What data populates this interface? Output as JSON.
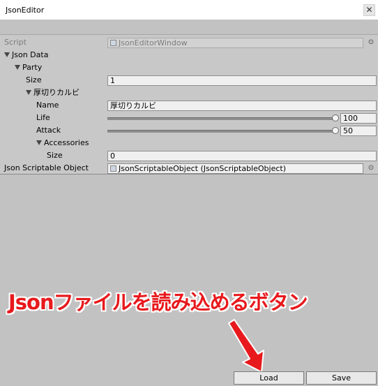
{
  "window": {
    "title": "JsonEditor",
    "close_glyph": "✕"
  },
  "inspector": {
    "script": {
      "label": "Script",
      "value": "JsonEditorWindow"
    },
    "json_data": {
      "label": "Json Data"
    },
    "party": {
      "label": "Party"
    },
    "party_size": {
      "label": "Size",
      "value": "1"
    },
    "member": {
      "label": "厚切りカルビ"
    },
    "name": {
      "label": "Name",
      "value": "厚切りカルビ"
    },
    "life": {
      "label": "Life",
      "value": "100",
      "slider_fraction": 1.0
    },
    "attack": {
      "label": "Attack",
      "value": "50",
      "slider_fraction": 1.0
    },
    "accessories": {
      "label": "Accessories"
    },
    "acc_size": {
      "label": "Size",
      "value": "0"
    },
    "scriptable": {
      "label": "Json Scriptable Object",
      "value": "JsonScriptableObject (JsonScriptableObject)"
    },
    "picker_glyph": "⊙"
  },
  "buttons": {
    "load": "Load",
    "save": "Save"
  },
  "annotation": {
    "text": "Jsonファイルを読み込めるボタン",
    "color": "#e8191c"
  }
}
